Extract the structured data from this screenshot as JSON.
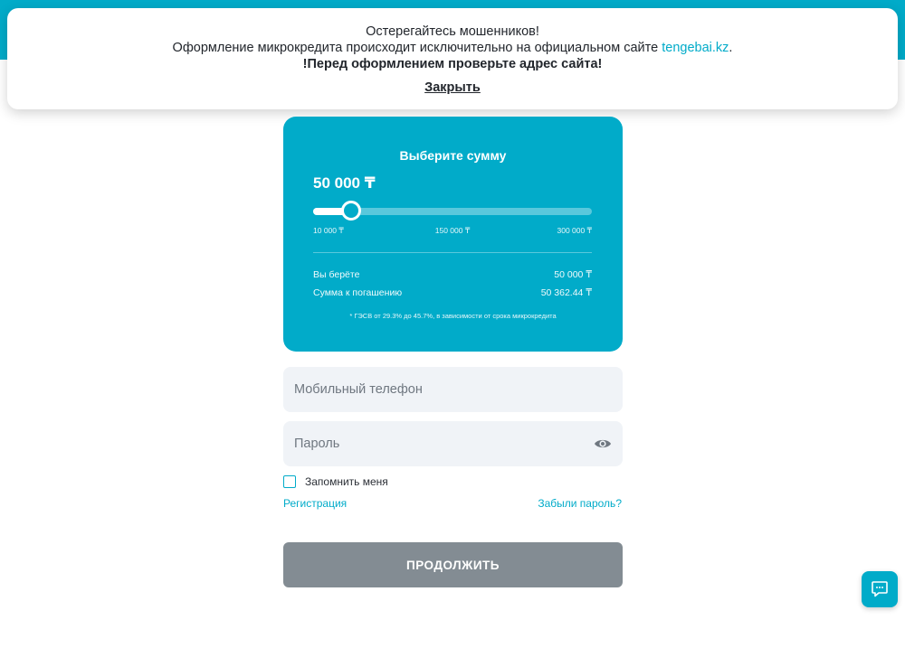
{
  "notice": {
    "line1": "Остерегайтесь мошенников!",
    "line2_prefix": "Оформление микрокредита происходит исключительно на официальном сайте ",
    "line2_link": "tengebai.kz",
    "line2_suffix": ".",
    "line3": "!Перед оформлением проверьте адрес сайта!",
    "close_label": "Закрыть"
  },
  "calculator": {
    "title": "Выберите сумму",
    "amount": "50 000 ₸",
    "slider": {
      "min": 10000,
      "max": 300000,
      "value": 50000
    },
    "ticks": {
      "min": "10 000 ₸",
      "mid": "150 000 ₸",
      "max": "300 000 ₸"
    },
    "rows": [
      {
        "label": "Вы берёте",
        "value": "50 000 ₸"
      },
      {
        "label": "Сумма к погашению",
        "value": "50 362.44 ₸"
      }
    ],
    "note": "* ГЭСВ от 29.3% до 45.7%, в зависимости от срока микрокредита"
  },
  "form": {
    "phone_placeholder": "Мобильный телефон",
    "password_placeholder": "Пароль",
    "remember_label": "Запомнить меня",
    "register_link": "Регистрация",
    "forgot_link": "Забыли пароль?",
    "continue_label": "ПРОДОЛЖИТЬ"
  },
  "icons": {
    "password_toggle": "eye-icon",
    "chat": "chat-icon"
  },
  "colors": {
    "accent": "#01abc9",
    "button_disabled": "#838c93",
    "field_bg": "#f0f3f7"
  }
}
